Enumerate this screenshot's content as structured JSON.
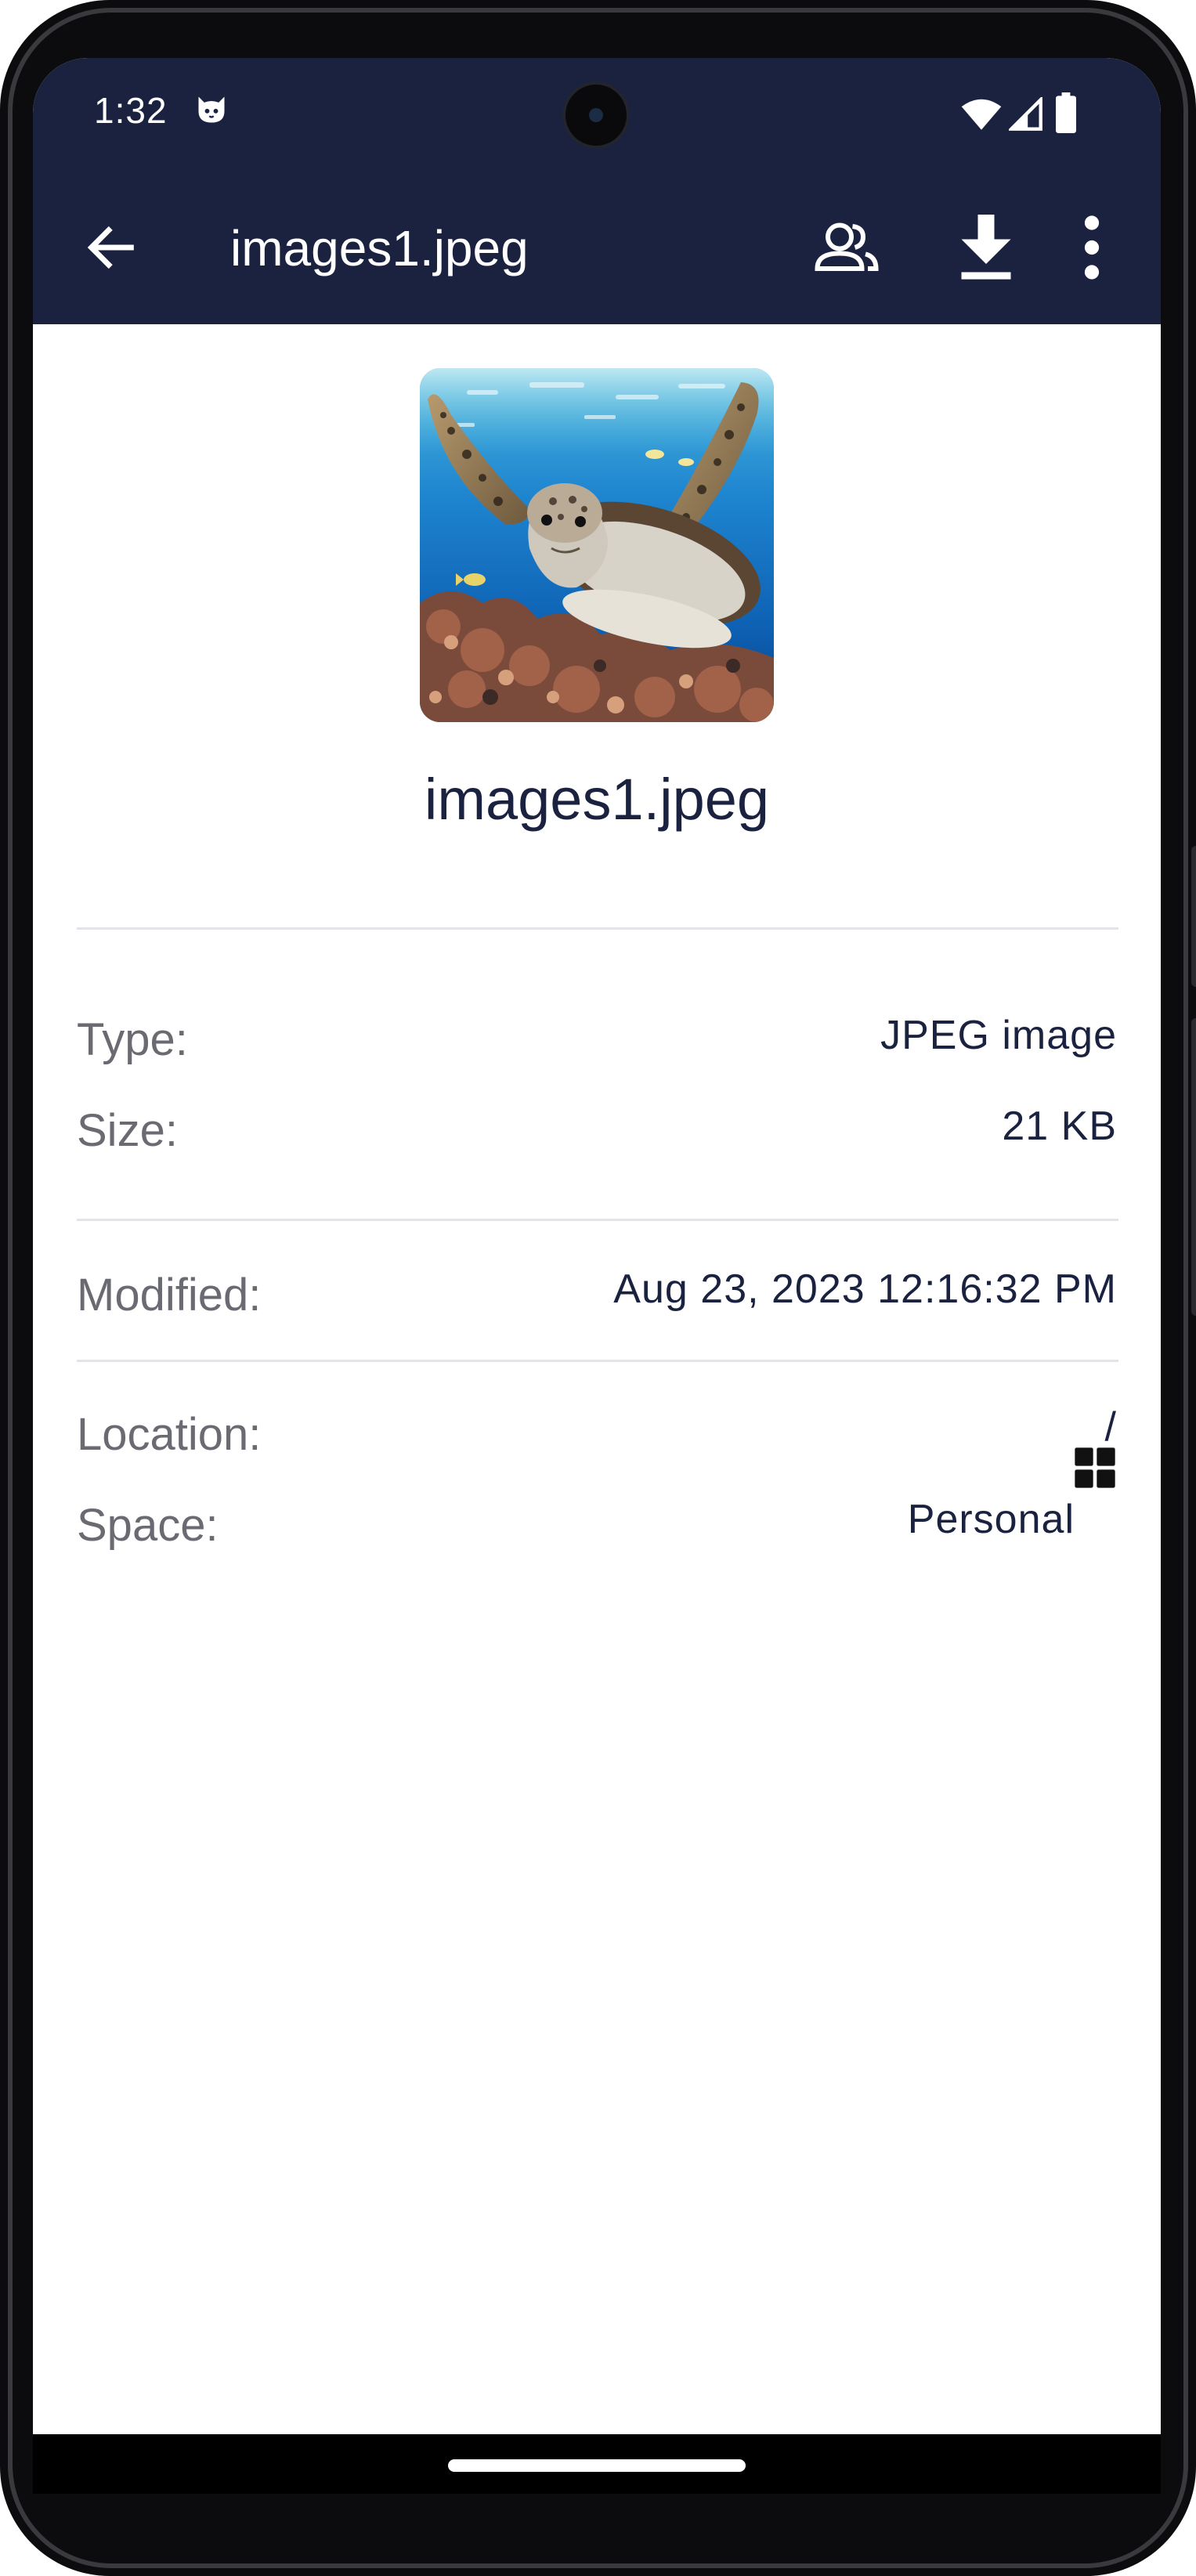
{
  "status_bar": {
    "time": "1:32",
    "notification_icon": "cat-face-icon",
    "wifi_icon": "wifi-icon",
    "signal_icon": "cell-signal-icon",
    "battery_icon": "battery-icon"
  },
  "app_bar": {
    "title": "images1.jpeg",
    "back_icon": "arrow-back-icon",
    "share_icon": "share-people-icon",
    "download_icon": "download-icon",
    "more_icon": "more-vert-icon"
  },
  "preview": {
    "file_name": "images1.jpeg",
    "thumbnail_subject": "sea turtle underwater"
  },
  "details": {
    "type": {
      "label": "Type:",
      "value": "JPEG image"
    },
    "size": {
      "label": "Size:",
      "value": "21 KB"
    },
    "modified": {
      "label": "Modified:",
      "value": "Aug 23, 2023 12:16:32 PM"
    },
    "location": {
      "label": "Location:",
      "value": "/"
    },
    "space": {
      "label": "Space:",
      "value": "Personal",
      "icon": "grid-icon"
    }
  },
  "colors": {
    "app_bar_bg": "#1a2240",
    "text_primary": "#1a2240",
    "text_label": "#6a6a72",
    "divider": "#e4e4e8"
  }
}
